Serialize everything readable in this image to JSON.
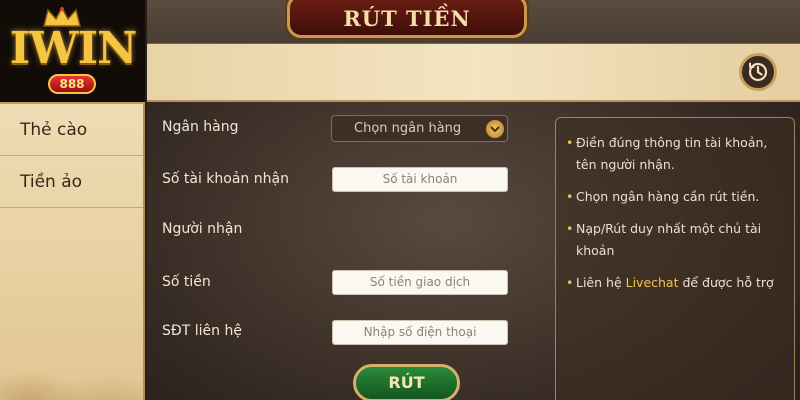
{
  "logo": {
    "text": "IWIN",
    "badge": "888"
  },
  "sidebar": {
    "items": [
      {
        "label": "Thẻ cào"
      },
      {
        "label": "Tiền ảo"
      }
    ]
  },
  "header": {
    "title": "RÚT TIỀN"
  },
  "form": {
    "bank_label": "Ngân hàng",
    "bank_select": "Chọn ngân hàng",
    "account_label": "Số tài khoản nhận",
    "account_placeholder": "Số tài khoản",
    "recipient_label": "Người nhận",
    "amount_label": "Số tiền",
    "amount_placeholder": "Số tiền giao dịch",
    "phone_label": "SĐT liên hệ",
    "phone_placeholder": "Nhập số điện thoại",
    "submit_label": "RÚT"
  },
  "notes": {
    "n1": "Điền đúng thông tin tài khoản, tên người nhận.",
    "n2": "Chọn ngân hàng cần rút tiền.",
    "n3": "Nạp/Rút duy nhất một chủ tài khoản",
    "n4_pre": "Liên hệ ",
    "n4_link": "Livechat",
    "n4_post": " để được hỗ trợ"
  },
  "colors": {
    "accent_gold": "#f2c54b",
    "submit_green": "#2a8a3a",
    "title_red": "#6b1e14"
  },
  "icons": {
    "history": "clock-history-icon",
    "dropdown": "chevron-down-icon"
  }
}
